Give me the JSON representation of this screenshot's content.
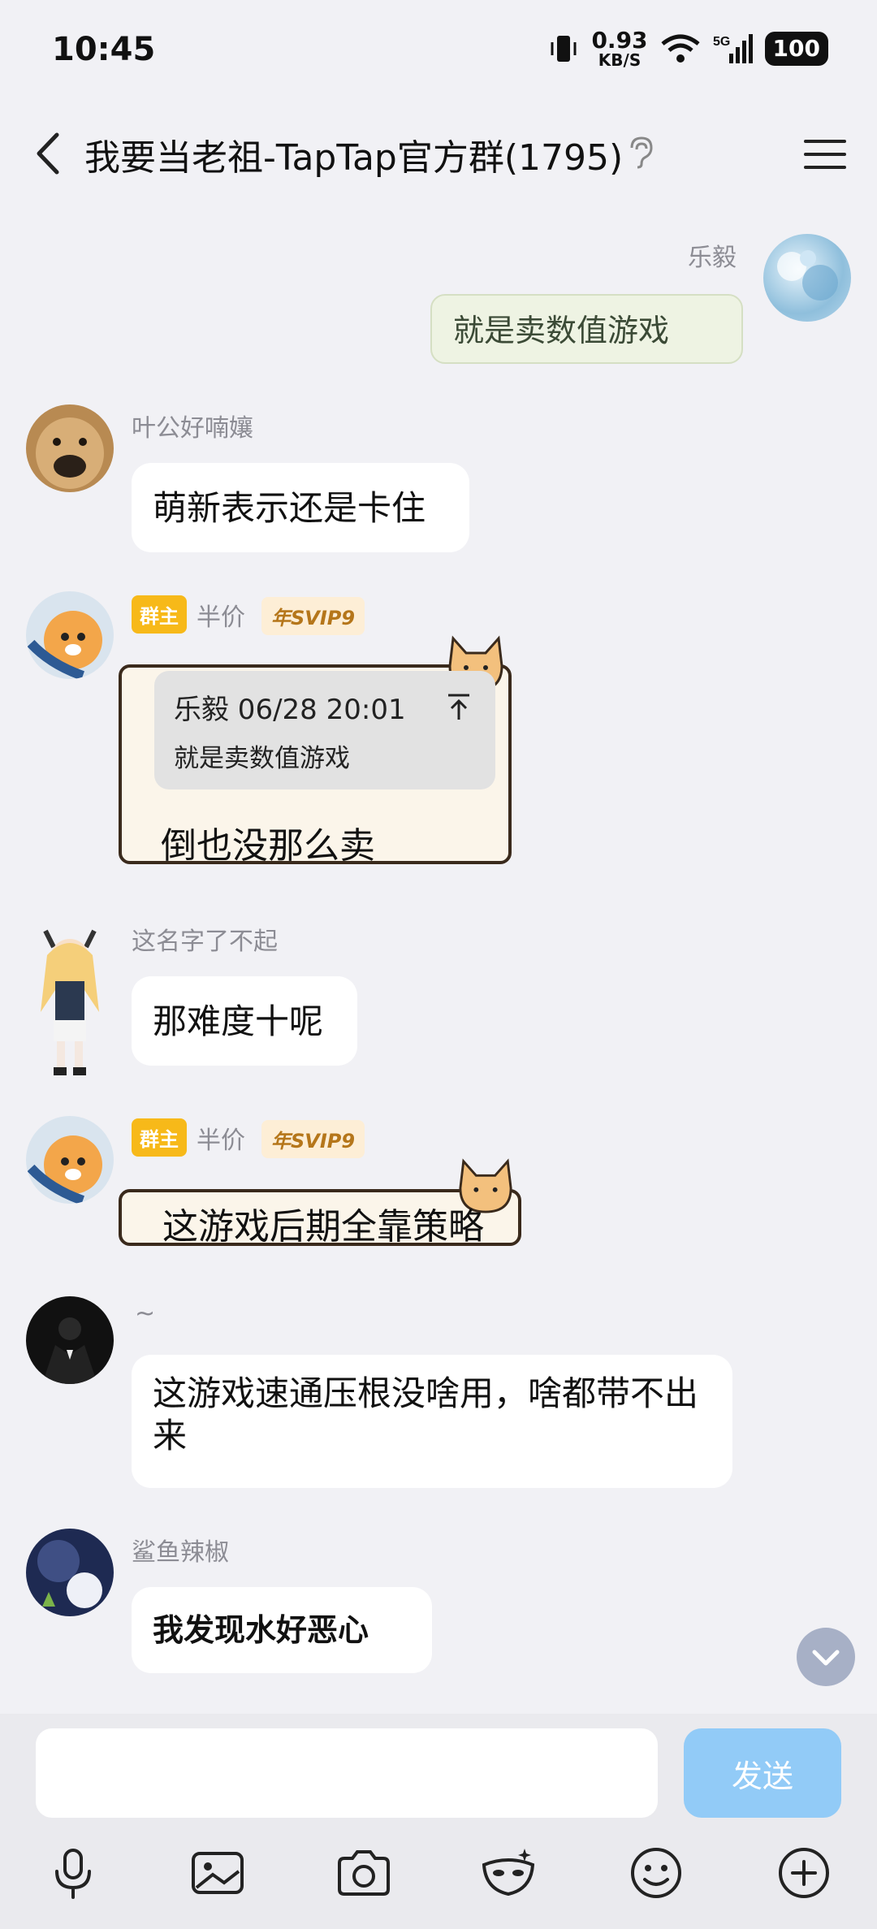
{
  "status": {
    "time": "10:45",
    "net_speed": "0.93",
    "net_unit": "KB/S",
    "network": "5G",
    "battery": "100"
  },
  "header": {
    "title": "我要当老祖-TapTap官方群(1795)"
  },
  "messages": [
    {
      "sender": "乐毅",
      "text": "就是卖数值游戏"
    },
    {
      "sender": "叶公好喃孃",
      "text": "萌新表示还是卡住"
    },
    {
      "sender": "半价",
      "owner_tag": "群主",
      "svip_tag": "年SVIP9",
      "quote_header": "乐毅 06/28 20:01",
      "quote_text": "就是卖数值游戏",
      "text": "倒也没那么卖"
    },
    {
      "sender": "这名字了不起",
      "text": "那难度十呢"
    },
    {
      "sender": "半价",
      "owner_tag": "群主",
      "svip_tag": "年SVIP9",
      "text": "这游戏后期全靠策略"
    },
    {
      "sender": "~",
      "text": "这游戏速通压根没啥用，啥都带不出来"
    },
    {
      "sender": "鲨鱼辣椒",
      "text": "我发现水好恶心"
    }
  ],
  "input": {
    "send_label": "发送"
  },
  "toolbar": {
    "icons": [
      "mic-icon",
      "image-icon",
      "camera-icon",
      "mask-icon",
      "emoji-icon",
      "plus-icon"
    ]
  }
}
